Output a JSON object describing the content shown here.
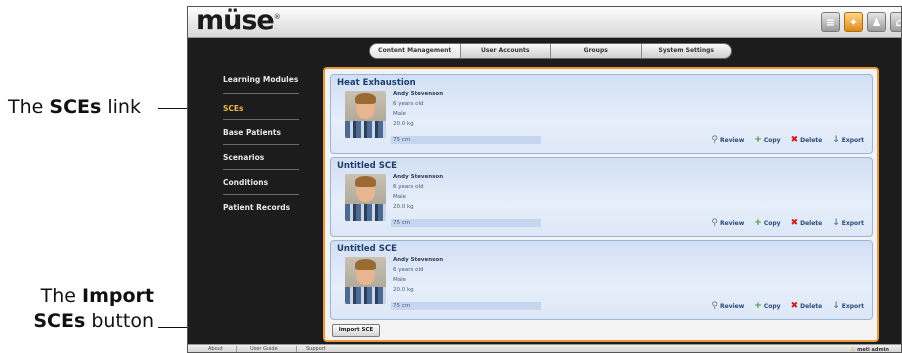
{
  "callouts": {
    "sces_prefix": "The ",
    "sces_bold": "SCEs",
    "sces_suffix": " link",
    "import_line1_prefix": "The ",
    "import_line1_bold": "Import",
    "import_line2_bold": "SCEs",
    "import_line2_suffix": " button"
  },
  "app": {
    "logo": "müse",
    "logo_mark": "®",
    "top_icons": [
      "notes-icon",
      "gear-icon",
      "user-icon",
      "home-icon"
    ]
  },
  "tabs": [
    "Content Management",
    "User Accounts",
    "Groups",
    "System Settings"
  ],
  "sidebar": {
    "items": [
      {
        "label": "Learning Modules",
        "active": false
      },
      {
        "label": "SCEs",
        "active": true
      },
      {
        "label": "Base Patients",
        "active": false
      },
      {
        "label": "Scenarios",
        "active": false
      },
      {
        "label": "Conditions",
        "active": false
      },
      {
        "label": "Patient Records",
        "active": false
      }
    ]
  },
  "sces": [
    {
      "title": "Heat Exhaustion",
      "name": "Andy Stevenson",
      "age": "6 years old",
      "sex": "Male",
      "weight": "20.0 kg",
      "height": "75 cm"
    },
    {
      "title": "Untitled SCE",
      "name": "Andy Stevenson",
      "age": "6 years old",
      "sex": "Male",
      "weight": "20.0 kg",
      "height": "75 cm"
    },
    {
      "title": "Untitled SCE",
      "name": "Andy Stevenson",
      "age": "6 years old",
      "sex": "Male",
      "weight": "20.0 kg",
      "height": "75 cm"
    }
  ],
  "actions": {
    "review": "Review",
    "copy": "Copy",
    "delete": "Delete",
    "export": "Export"
  },
  "import_button": "Import SCE",
  "footer": {
    "about": "About",
    "user_guide": "User Guide",
    "support": "Support",
    "user": "meti admin"
  },
  "colors": {
    "accent_border": "#e89a3a",
    "active_sidebar": "#e8b84a",
    "card_title": "#1f3d6e"
  }
}
